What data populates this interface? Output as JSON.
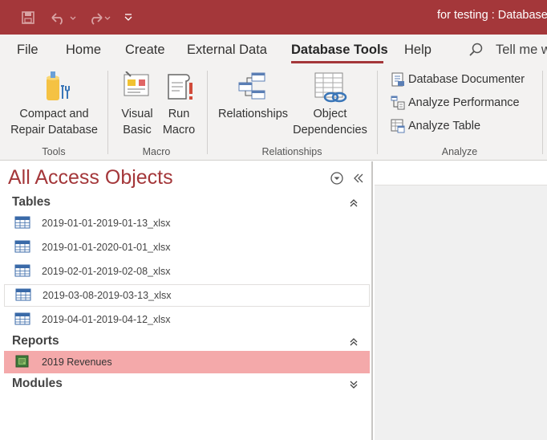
{
  "window": {
    "title": "for testing : Database"
  },
  "tabs": [
    "File",
    "Home",
    "Create",
    "External Data",
    "Database Tools",
    "Help"
  ],
  "active_tab": "Database Tools",
  "tell_me": "Tell me w",
  "ribbon": {
    "tools": {
      "compact_line1": "Compact and",
      "compact_line2": "Repair Database",
      "group": "Tools"
    },
    "macro": {
      "vb_line1": "Visual",
      "vb_line2": "Basic",
      "run_line1": "Run",
      "run_line2": "Macro",
      "group": "Macro"
    },
    "relationships": {
      "rel": "Relationships",
      "dep_line1": "Object",
      "dep_line2": "Dependencies",
      "group": "Relationships"
    },
    "analyze": {
      "documenter": "Database Documenter",
      "performance": "Analyze Performance",
      "table": "Analyze Table",
      "group": "Analyze"
    }
  },
  "nav": {
    "title": "All Access Objects",
    "sections": {
      "tables": "Tables",
      "reports": "Reports",
      "modules": "Modules"
    },
    "tables": [
      "2019-01-01-2019-01-13_xlsx",
      "2019-01-01-2020-01-01_xlsx",
      "2019-02-01-2019-02-08_xlsx",
      "2019-03-08-2019-03-13_xlsx",
      "2019-04-01-2019-04-12_xlsx"
    ],
    "reports": [
      "2019 Revenues"
    ]
  },
  "colors": {
    "accent": "#a4373a",
    "selected": "#f4a9aa",
    "ribbon_bg": "#f3f2f1"
  }
}
